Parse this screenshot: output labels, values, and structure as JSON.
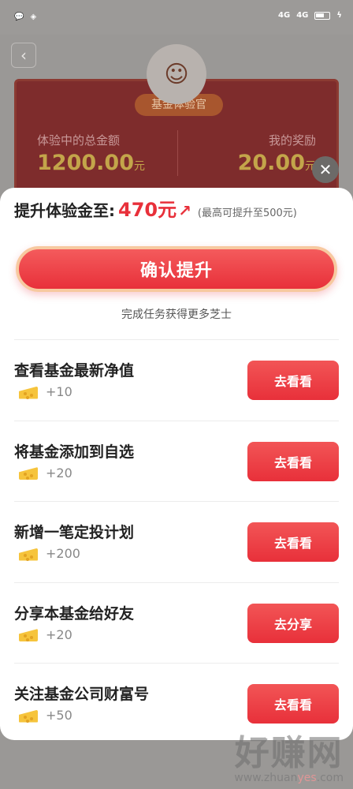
{
  "status_bar": {
    "left_icons": [
      "chat-icon",
      "layers-icon"
    ],
    "network_1": "4G",
    "network_2": "4G"
  },
  "background": {
    "badge": "基金体验官",
    "left_label": "体验中的总金额",
    "left_value": "1200.00",
    "left_unit": "元",
    "right_label": "我的奖励",
    "right_value": "20.00",
    "right_unit": "元"
  },
  "sheet": {
    "headline_label": "提升体验金至:",
    "headline_value": "470元",
    "headline_note": "(最高可提升至500元)",
    "confirm_label": "确认提升",
    "hint": "完成任务获得更多芝士",
    "tasks": [
      {
        "title": "查看基金最新净值",
        "points": "+10",
        "button": "去看看"
      },
      {
        "title": "将基金添加到自选",
        "points": "+20",
        "button": "去看看"
      },
      {
        "title": "新增一笔定投计划",
        "points": "+200",
        "button": "去看看"
      },
      {
        "title": "分享本基金给好友",
        "points": "+20",
        "button": "去分享"
      },
      {
        "title": "关注基金公司财富号",
        "points": "+50",
        "button": "去看看"
      }
    ]
  },
  "watermark": {
    "main": "好赚网",
    "url_pre": "www.zhuan",
    "url_mid": "yes",
    "url_post": ".com"
  },
  "colors": {
    "accent": "#e8303a",
    "cheese": "#f6c43c"
  }
}
